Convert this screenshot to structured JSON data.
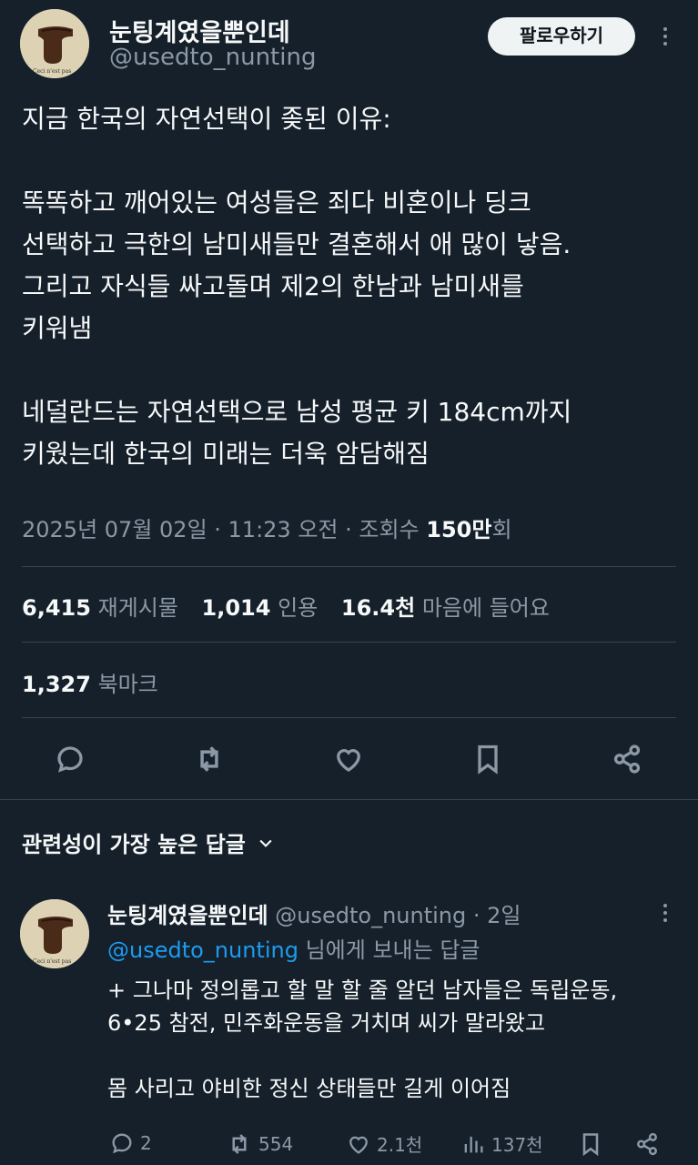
{
  "tweet": {
    "display_name": "눈팅계였을뿐인데",
    "handle": "@usedto_nunting",
    "follow_label": "팔로우하기",
    "body": "지금 한국의 자연선택이 좆된 이유:\n\n똑똑하고 깨어있는 여성들은 죄다 비혼이나 딩크\n선택하고 극한의 남미새들만 결혼해서 애 많이 낳음.\n그리고 자식들 싸고돌며 제2의 한남과 남미새를\n키워냄\n\n네덜란드는 자연선택으로 남성 평균 키 184cm까지\n키웠는데 한국의 미래는 더욱 암담해짐",
    "meta_date": "2025년 07월 02일 · 11:23 오전 · 조회수 ",
    "meta_views": "150만",
    "meta_views_suffix": "회",
    "stats": {
      "reposts_num": "6,415",
      "reposts_label": "재게시물",
      "quotes_num": "1,014",
      "quotes_label": "인용",
      "likes_num": "16.4천",
      "likes_label": "마음에 들어요",
      "bookmarks_num": "1,327",
      "bookmarks_label": "북마크"
    },
    "actions": [
      "reply-icon",
      "repost-icon",
      "like-icon",
      "bookmark-icon",
      "share-icon"
    ]
  },
  "replies_section": {
    "sort_label": "관련성이 가장 높은 답글"
  },
  "reply": {
    "display_name": "눈팅계였을뿐인데",
    "handle_time": "@usedto_nunting · 2일",
    "replying_to_handle": "@usedto_nunting",
    "replying_to_suffix": " 님에게 보내는 답글",
    "body": "+ 그나마 정의롭고 할 말 할 줄 알던 남자들은 독립운동,\n6•25 참전, 민주화운동을 거치며 씨가 말라왔고\n\n몸 사리고 야비한 정신 상태들만 길게 이어짐",
    "actions": {
      "replies": "2",
      "reposts": "554",
      "likes": "2.1천",
      "views": "137천"
    }
  },
  "colors": {
    "background": "#15202b",
    "text": "#f7f9f9",
    "muted": "#8b98a5",
    "link": "#1d9bf0",
    "divider": "#38444d"
  }
}
